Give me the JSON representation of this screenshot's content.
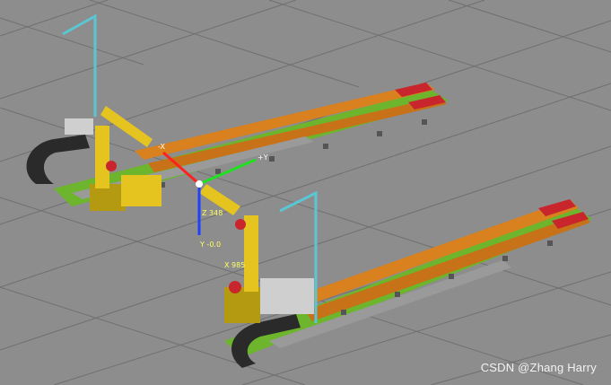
{
  "viewport": {
    "background": "#8d8d8d",
    "grid_color": "#6e6e6e"
  },
  "colors": {
    "robot": "#e5c420",
    "robot_dark": "#b39a10",
    "rail_green": "#6cb52c",
    "rail_orange": "#d9801f",
    "rail_red": "#c8262c",
    "cable_chain": "#2a2a2a",
    "mast": "#5bc6d3",
    "axis_x": "#ff2020",
    "axis_y": "#20e020",
    "axis_z": "#2040ff"
  },
  "gizmo": {
    "x_label": "-X",
    "y_label": "+Y",
    "z_value": "Z 348",
    "y_value": "Y -0.0",
    "x_value": "X 985"
  },
  "watermark": "CSDN @Zhang Harry"
}
